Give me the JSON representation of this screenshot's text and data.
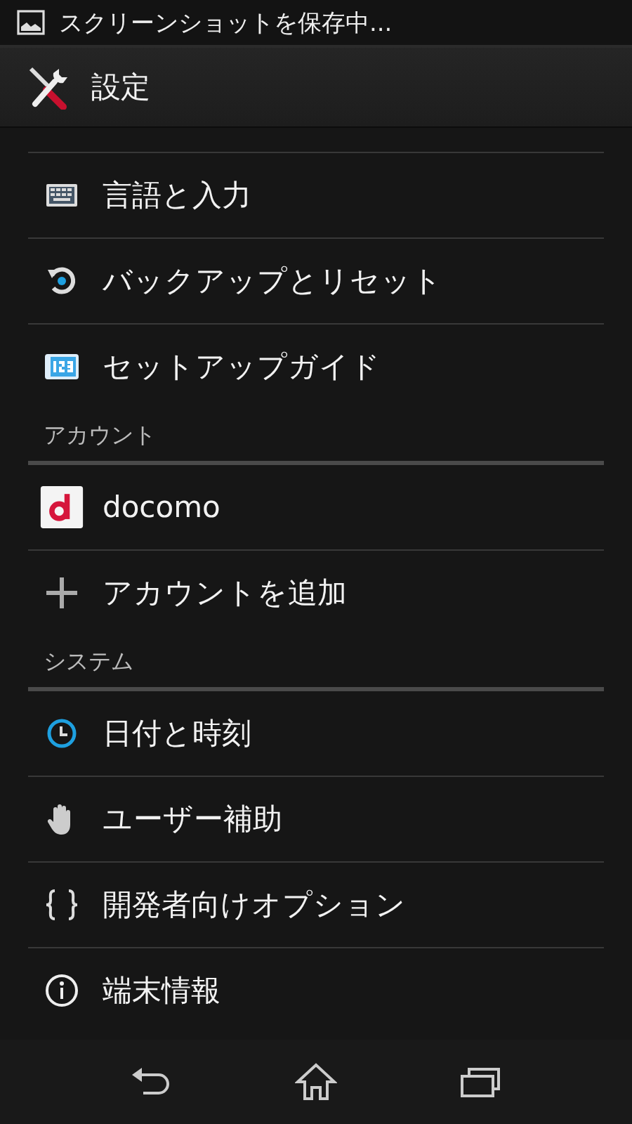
{
  "status_bar": {
    "notification": "スクリーンショットを保存中..."
  },
  "action_bar": {
    "title": "設定"
  },
  "sections": [
    {
      "items": [
        {
          "label": "言語と入力"
        },
        {
          "label": "バックアップとリセット"
        },
        {
          "label": "セットアップガイド"
        }
      ]
    },
    {
      "header": "アカウント",
      "items": [
        {
          "label": "docomo"
        },
        {
          "label": "アカウントを追加"
        }
      ]
    },
    {
      "header": "システム",
      "items": [
        {
          "label": "日付と時刻"
        },
        {
          "label": "ユーザー補助"
        },
        {
          "label": "開発者向けオプション"
        },
        {
          "label": "端末情報"
        }
      ]
    }
  ]
}
